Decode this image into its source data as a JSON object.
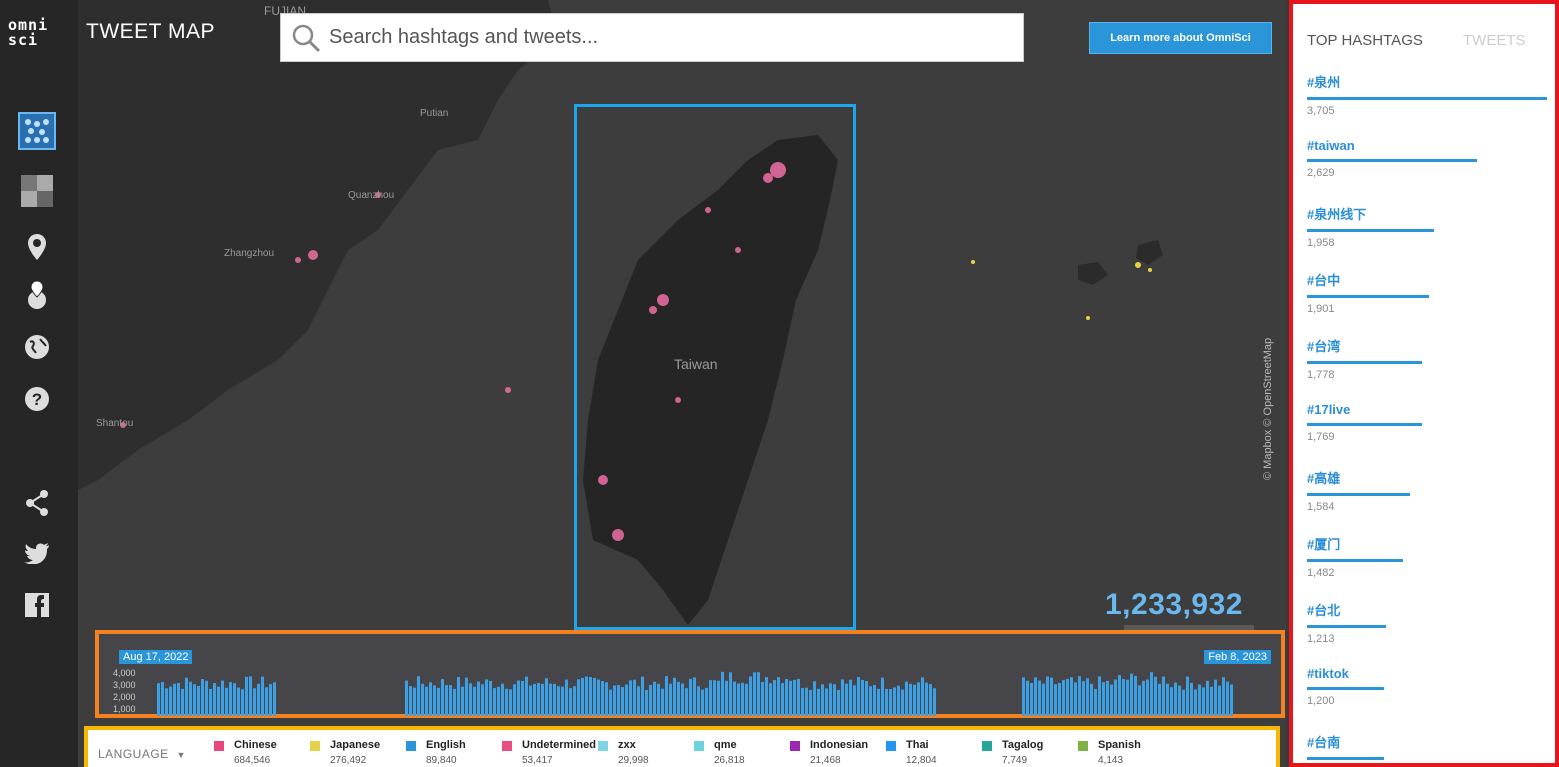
{
  "app": {
    "logo": "omni sci",
    "title": "TWEET MAP"
  },
  "search": {
    "placeholder": "Search hashtags and tweets..."
  },
  "learn_more_button": "Learn more about OmniSci",
  "map": {
    "labels": [
      "FUJIAN",
      "Quanzhou",
      "Zhangzhou",
      "Shantou",
      "Taiwan",
      "Putian"
    ],
    "attribution": "© Mapbox © OpenStreetMap",
    "tweet_count": "1,233,932"
  },
  "sidebar": {
    "icons": [
      "points-icon",
      "heatmap-icon",
      "location-pin-icon",
      "geo-locate-icon",
      "globe-icon",
      "help-icon",
      "share-icon",
      "twitter-icon",
      "facebook-icon"
    ]
  },
  "timeline": {
    "start_date": "Aug 17, 2022",
    "end_date": "Feb 8, 2023",
    "y_ticks": [
      "4,000",
      "3,000",
      "2,000",
      "1,000"
    ]
  },
  "legend": {
    "title": "LANGUAGE",
    "items": [
      {
        "name": "Chinese",
        "count": "684,546",
        "color": "#e8467c"
      },
      {
        "name": "Japanese",
        "count": "276,492",
        "color": "#e6d14a"
      },
      {
        "name": "English",
        "count": "89,840",
        "color": "#2a95d9"
      },
      {
        "name": "Undetermined",
        "count": "53,417",
        "color": "#e94f84"
      },
      {
        "name": "zxx",
        "count": "29,998",
        "color": "#7ed4e6"
      },
      {
        "name": "qme",
        "count": "26,818",
        "color": "#6dd1e0"
      },
      {
        "name": "Indonesian",
        "count": "21,468",
        "color": "#9c27b0"
      },
      {
        "name": "Thai",
        "count": "12,804",
        "color": "#2196f3"
      },
      {
        "name": "Tagalog",
        "count": "7,749",
        "color": "#26a69a"
      },
      {
        "name": "Spanish",
        "count": "4,143",
        "color": "#7cb342"
      }
    ]
  },
  "panel": {
    "tabs": [
      "TOP HASHTAGS",
      "TWEETS"
    ],
    "hashtags": [
      {
        "tag": "#泉州",
        "count": "3,705",
        "value": 1.0
      },
      {
        "tag": "#taiwan",
        "count": "2,629",
        "value": 0.71
      },
      {
        "tag": "#泉州线下",
        "count": "1,958",
        "value": 0.53
      },
      {
        "tag": "#台中",
        "count": "1,901",
        "value": 0.51
      },
      {
        "tag": "#台湾",
        "count": "1,778",
        "value": 0.48
      },
      {
        "tag": "#17live",
        "count": "1,769",
        "value": 0.48
      },
      {
        "tag": "#高雄",
        "count": "1,584",
        "value": 0.43
      },
      {
        "tag": "#厦门",
        "count": "1,482",
        "value": 0.4
      },
      {
        "tag": "#台北",
        "count": "1,213",
        "value": 0.33
      },
      {
        "tag": "#tiktok",
        "count": "1,200",
        "value": 0.32
      },
      {
        "tag": "#台南",
        "count": "",
        "value": 0.32
      }
    ]
  },
  "colors": {
    "accent": "#2a95d9",
    "highlight_red": "#e8151b",
    "highlight_orange": "#f58220",
    "highlight_yellow": "#f6b800",
    "highlight_blue": "#1ea7e8"
  }
}
